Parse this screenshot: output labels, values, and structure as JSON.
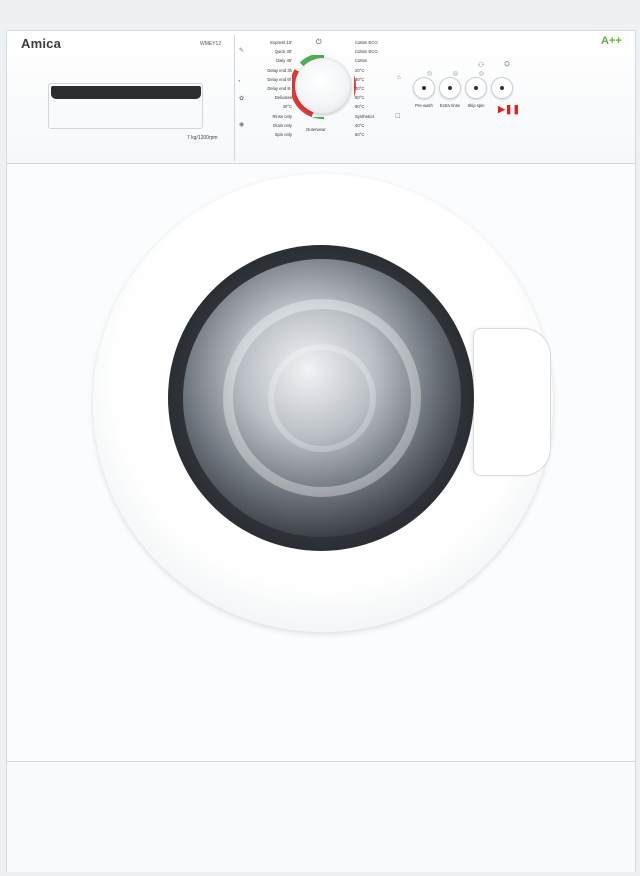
{
  "brand": {
    "logo": "Amica",
    "model": "WMEY12",
    "capacity": "7 kg/1200rpm",
    "energy_class": "A++",
    "energy_color": "#5cb531"
  },
  "programs_left": [
    "Express 15'",
    "Quick 30'",
    "Daily 45'",
    "Delay end 3h",
    "Delay end 6h",
    "Delay end 9h",
    "Delicates",
    "30°C",
    "Rinse only",
    "Drain only",
    "Spin only"
  ],
  "programs_right": [
    "Cotton ECO",
    "Cotton ECO",
    "Cotton",
    "20°C",
    "30°C",
    "40°C",
    "60°C",
    "90°C",
    "Synthetics",
    "40°C",
    "60°C"
  ],
  "dial": {
    "bottom_label": "Outerwear",
    "ring_colors": [
      "#e23a3a",
      "#4caf50"
    ]
  },
  "buttons": [
    {
      "label": "Pre-wash"
    },
    {
      "label": "Extra rinse"
    },
    {
      "label": "Skip spin"
    },
    {
      "label": "Start/Pause"
    }
  ],
  "icons": {
    "power": "power-icon",
    "start_pause": "play-pause-icon",
    "play_symbol": "▶❚❚"
  },
  "accent_red": "#e02020"
}
